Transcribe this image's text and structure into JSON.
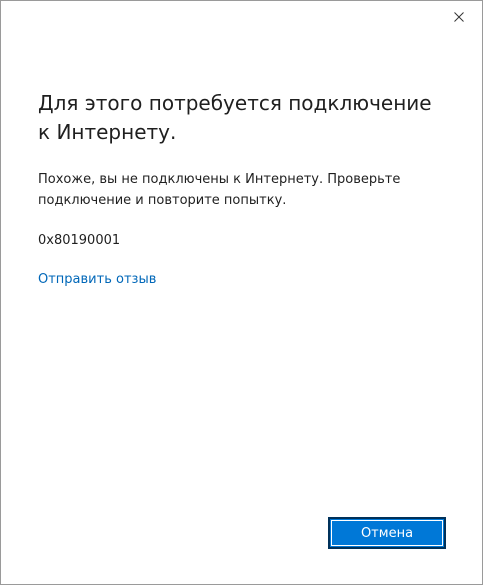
{
  "dialog": {
    "close_icon": "close-icon",
    "title": "Для этого потребуется подключение к Интернету.",
    "message": "Похоже, вы не подключены к Интернету. Проверьте подключение и повторите попытку.",
    "error_code": "0x80190001",
    "feedback_link": "Отправить отзыв",
    "cancel_button": "Отмена"
  },
  "colors": {
    "accent": "#0078d7",
    "link": "#0067b8",
    "text": "#1f1f1f",
    "background": "#ffffff"
  }
}
